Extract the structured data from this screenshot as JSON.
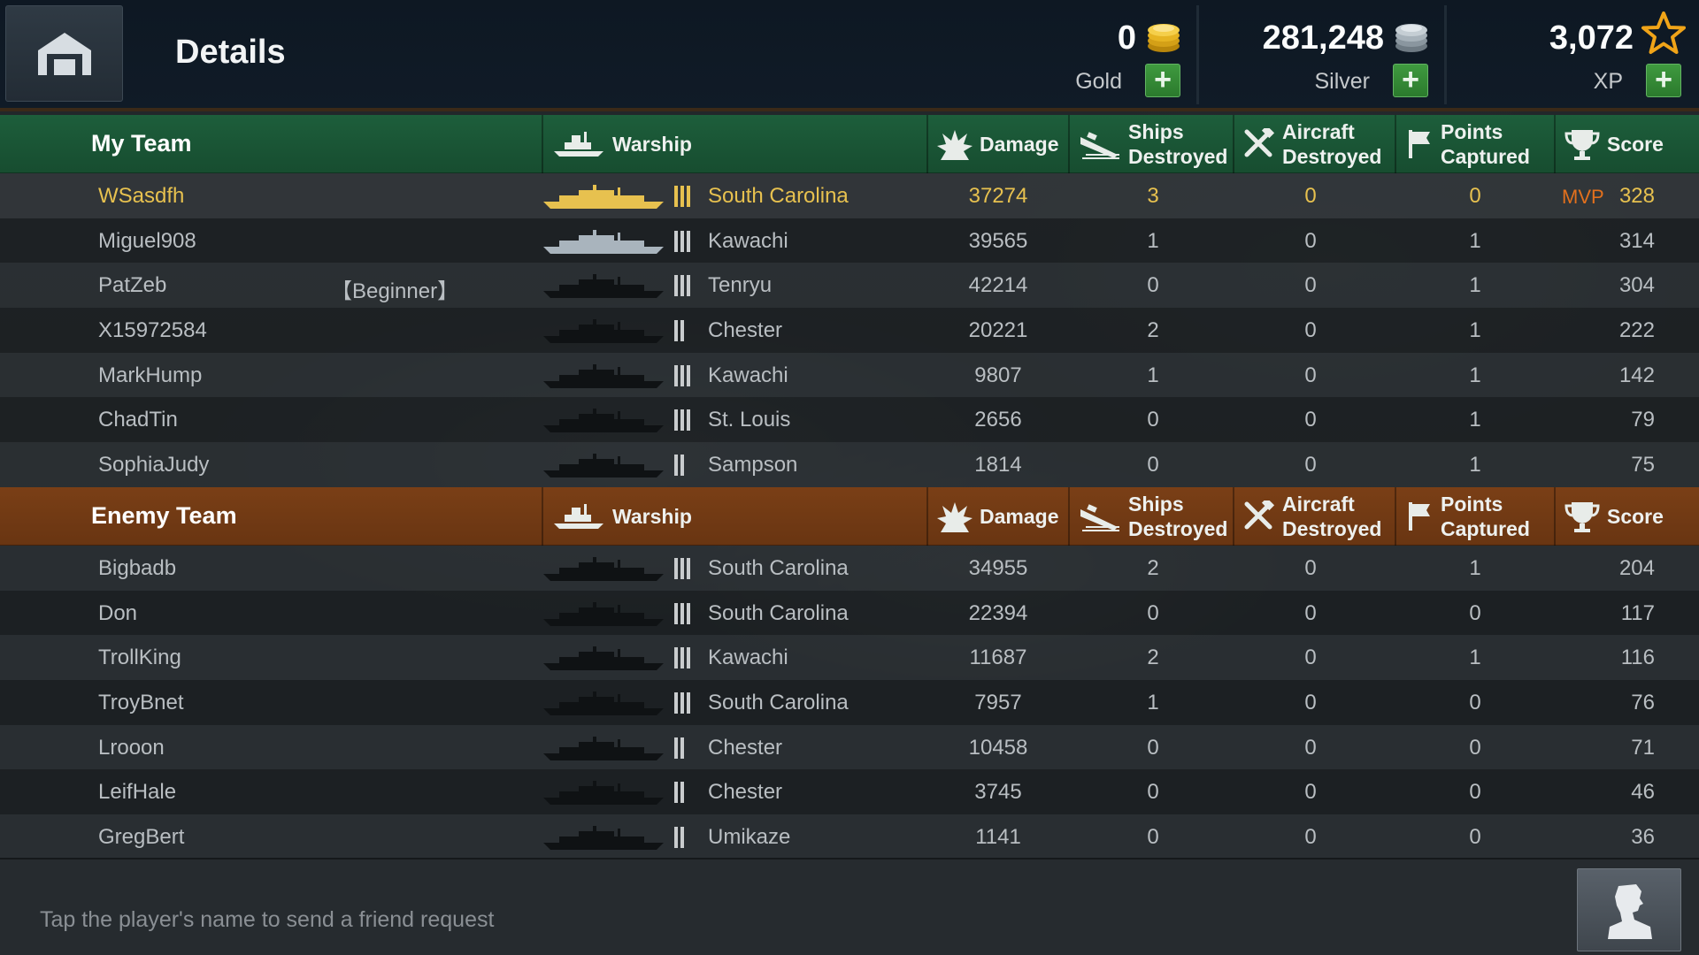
{
  "header": {
    "title": "Details",
    "resources": [
      {
        "id": "gold",
        "value": "0",
        "label": "Gold",
        "icon": "gold-coins-icon"
      },
      {
        "id": "silver",
        "value": "281,248",
        "label": "Silver",
        "icon": "silver-coins-icon"
      },
      {
        "id": "xp",
        "value": "3,072",
        "label": "XP",
        "icon": "star-icon"
      }
    ],
    "plus_label": "+"
  },
  "columns": {
    "warship": "Warship",
    "damage": "Damage",
    "ships_destroyed": [
      "Ships",
      "Destroyed"
    ],
    "aircraft_destroyed": [
      "Aircraft",
      "Destroyed"
    ],
    "points_captured": [
      "Points",
      "Captured"
    ],
    "score": "Score"
  },
  "my_team": {
    "name": "My Team",
    "color": "#1d5e3b",
    "players": [
      {
        "name": "WSasdfh",
        "tag": "",
        "tier": 3,
        "ship": "South Carolina",
        "damage": "37274",
        "ships": "3",
        "aircraft": "0",
        "points": "0",
        "score": "328",
        "mvp": "MVP",
        "highlight": true
      },
      {
        "name": "Miguel908",
        "tag": "",
        "tier": 3,
        "ship": "Kawachi",
        "damage": "39565",
        "ships": "1",
        "aircraft": "0",
        "points": "1",
        "score": "314",
        "mvp": ""
      },
      {
        "name": "PatZeb",
        "tag": "【Beginner】",
        "tier": 3,
        "ship": "Tenryu",
        "damage": "42214",
        "ships": "0",
        "aircraft": "0",
        "points": "1",
        "score": "304",
        "mvp": ""
      },
      {
        "name": "X15972584",
        "tag": "",
        "tier": 2,
        "ship": "Chester",
        "damage": "20221",
        "ships": "2",
        "aircraft": "0",
        "points": "1",
        "score": "222",
        "mvp": ""
      },
      {
        "name": "MarkHump",
        "tag": "",
        "tier": 3,
        "ship": "Kawachi",
        "damage": "9807",
        "ships": "1",
        "aircraft": "0",
        "points": "1",
        "score": "142",
        "mvp": ""
      },
      {
        "name": "ChadTin",
        "tag": "",
        "tier": 3,
        "ship": "St. Louis",
        "damage": "2656",
        "ships": "0",
        "aircraft": "0",
        "points": "1",
        "score": "79",
        "mvp": ""
      },
      {
        "name": "SophiaJudy",
        "tag": "",
        "tier": 2,
        "ship": "Sampson",
        "damage": "1814",
        "ships": "0",
        "aircraft": "0",
        "points": "1",
        "score": "75",
        "mvp": ""
      }
    ]
  },
  "enemy_team": {
    "name": "Enemy Team",
    "color": "#7a3f16",
    "players": [
      {
        "name": "Bigbadb",
        "tag": "",
        "tier": 3,
        "ship": "South Carolina",
        "damage": "34955",
        "ships": "2",
        "aircraft": "0",
        "points": "1",
        "score": "204",
        "mvp": ""
      },
      {
        "name": "Don",
        "tag": "",
        "tier": 3,
        "ship": "South Carolina",
        "damage": "22394",
        "ships": "0",
        "aircraft": "0",
        "points": "0",
        "score": "117",
        "mvp": ""
      },
      {
        "name": "TrollKing",
        "tag": "",
        "tier": 3,
        "ship": "Kawachi",
        "damage": "11687",
        "ships": "2",
        "aircraft": "0",
        "points": "1",
        "score": "116",
        "mvp": ""
      },
      {
        "name": "TroyBnet",
        "tag": "",
        "tier": 3,
        "ship": "South Carolina",
        "damage": "7957",
        "ships": "1",
        "aircraft": "0",
        "points": "0",
        "score": "76",
        "mvp": ""
      },
      {
        "name": "Lrooon",
        "tag": "",
        "tier": 2,
        "ship": "Chester",
        "damage": "10458",
        "ships": "0",
        "aircraft": "0",
        "points": "0",
        "score": "71",
        "mvp": ""
      },
      {
        "name": "LeifHale",
        "tag": "",
        "tier": 2,
        "ship": "Chester",
        "damage": "3745",
        "ships": "0",
        "aircraft": "0",
        "points": "0",
        "score": "46",
        "mvp": ""
      },
      {
        "name": "GregBert",
        "tag": "",
        "tier": 2,
        "ship": "Umikaze",
        "damage": "1141",
        "ships": "0",
        "aircraft": "0",
        "points": "0",
        "score": "36",
        "mvp": ""
      }
    ]
  },
  "footer": {
    "hint": "Tap the player's name to send a friend request",
    "friend_button_icon": "add-friend-icon"
  },
  "colors": {
    "highlight": "#e7c14f",
    "mvp": "#e2701d",
    "plus_button": "#3f9a3f"
  }
}
